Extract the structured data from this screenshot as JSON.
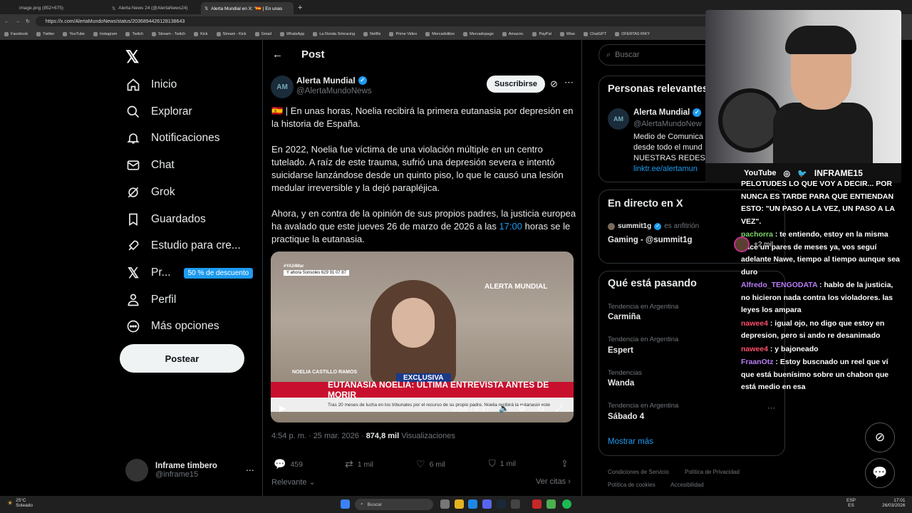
{
  "browser": {
    "tabs": [
      {
        "title": "image.png (852×675)"
      },
      {
        "title": "Alerta News 24 (@AlertaNews24)"
      },
      {
        "title": "Alerta Mundial en X: \"🇪🇸 | En unas"
      }
    ],
    "url": "https://x.com/AlertaMundoNews/status/2036894426128138643",
    "bookmarks": [
      "Facebook",
      "Twitter",
      "YouTube",
      "Instagram",
      "Twitch",
      "Stream - Twitch",
      "Kick",
      "Stream - Kick",
      "Gmail",
      "WhatsApp",
      "La Ronda Simracing",
      "Netflix",
      "Prime Video",
      "Mercadolibre",
      "Mercadopago",
      "Amazon.",
      "PayPal",
      "Wise",
      "ChatGPT",
      "OFERTAS RIKY"
    ]
  },
  "nav": {
    "items": [
      {
        "label": "Inicio",
        "icon": "home-icon"
      },
      {
        "label": "Explorar",
        "icon": "search-icon"
      },
      {
        "label": "Notificaciones",
        "icon": "bell-icon"
      },
      {
        "label": "Chat",
        "icon": "mail-icon"
      },
      {
        "label": "Grok",
        "icon": "grok-icon"
      },
      {
        "label": "Guardados",
        "icon": "bookmark-icon"
      },
      {
        "label": "Estudio para cre...",
        "icon": "rocket-icon"
      },
      {
        "label": "Pr...",
        "icon": "x-logo-icon"
      },
      {
        "label": "Perfil",
        "icon": "person-icon"
      },
      {
        "label": "Más opciones",
        "icon": "more-circle-icon"
      }
    ],
    "promo_badge": "50 % de descuento",
    "post_button": "Postear",
    "account": {
      "name": "Inframe timbero",
      "handle": "@inframe15"
    }
  },
  "post": {
    "header": "Post",
    "author": {
      "name": "Alerta Mundial",
      "handle": "@AlertaMundoNews"
    },
    "subscribe": "Suscribirse",
    "text_p1": "🇪🇸 | En unas horas, Noelia recibirá la primera eutanasia por depresión en la historia de España.",
    "text_p2": "En 2022, Noelia fue víctima de una violación múltiple en un centro tutelado. A raíz de este trauma, sufrió una depresión severa e intentó suicidarse lanzándose desde un quinto piso, lo que le causó una lesión medular irreversible y la dejó parapléjica.",
    "text_p3_a": "Ahora, y en contra de la opinión de sus propios padres, la justicia europea ha avalado que este jueves 26 de marzo de 2026 a las ",
    "text_p3_link": "17:00",
    "text_p3_b": " horas se le practique la eutanasia.",
    "media": {
      "tag": "#YA24Mar",
      "phone": "Y ahora Sonsoles  629 91 07 87",
      "brand": "ALERTA MUNDIAL",
      "name": "NOELIA CASTILLO RAMOS",
      "exclusive": "EXCLUSIVA",
      "headline": "EUTANASIA NOELIA: ÚLTIMA ENTREVISTA ANTES DE MORIR",
      "subline": "Tras 20 meses de lucha en los tribunales por el recurso de su propio padre, Noelia recibirá la eutanasia este",
      "time": "0:05 / 4:37"
    },
    "timestamp": "4:54 p. m. · 25 mar. 2026 · ",
    "views_count": "874,8 mil",
    "views_label": " Visualizaciones",
    "replies": "459",
    "reposts": "1 mil",
    "likes": "6 mil",
    "bookmarks": "1 mil",
    "relevant": "Relevante",
    "quotes": "Ver citas"
  },
  "right": {
    "search_placeholder": "Buscar",
    "relevant_title": "Personas relevantes",
    "rel_name": "Alerta Mundial",
    "rel_handle": "@AlertaMundoNew",
    "rel_bio_1": "Medio de Comunica",
    "rel_bio_2": "desde todo el mund",
    "rel_bio_3": "NUESTRAS REDES:",
    "rel_link": "linktr.ee/alertamun",
    "live_title": "En directo en X",
    "live_host": "summit1g",
    "live_host_tag": "es anfitrión",
    "live_count": "+2 mil",
    "live_stream": "Gaming - @summit1g",
    "trends_title": "Qué está pasando",
    "trends": [
      {
        "category": "Tendencia en Argentina",
        "name": "Carmiña"
      },
      {
        "category": "Tendencia en Argentina",
        "name": "Espert"
      },
      {
        "category": "Tendencias",
        "name": "Wanda"
      },
      {
        "category": "Tendencia en Argentina",
        "name": "Sábado 4"
      }
    ],
    "show_more": "Mostrar más",
    "footer": [
      "Condiciones de Servicio",
      "Política de Privacidad",
      "Política de cookies",
      "Accesibilidad"
    ]
  },
  "stream": {
    "cam_bar": [
      "YouTube",
      "INFRAME15"
    ],
    "chat": [
      {
        "user": "",
        "text": "PELOTUDES LO QUE VOY A DECIR... POR NUNCA ES TARDE PARA QUE ENTIENDAN ESTO: \"UN PASO A LA VEZ, UN PASO A LA VEZ\".",
        "color": "#ffffff"
      },
      {
        "user": "pachorra",
        "text": " : te entiendo, estoy en la misma hace un pares de meses ya, vos seguí adelante Nawe, tiempo al tiempo aunque sea duro",
        "color": "#7fd36b"
      },
      {
        "user": "Alfredo_TENGODATA",
        "text": " : hablo de la justicia, no hicieron nada contra los violadores. las leyes los ampara",
        "color": "#b97cf7"
      },
      {
        "user": "nawee4",
        "text": " : igual ojo, no digo que estoy en depresion, pero si ando re desanimado",
        "color": "#ff4f6d"
      },
      {
        "user": "nawee4",
        "text": " : y bajoneado",
        "color": "#ff4f6d"
      },
      {
        "user": "FraanOtz",
        "text": " : Estoy buscnado un reel que ví que está buenísimo sobre un chabon que está medio en esa",
        "color": "#b97cf7"
      }
    ]
  },
  "taskbar": {
    "weather_temp": "25°C",
    "weather_desc": "Soleado",
    "search": "Buscar",
    "lang1": "ESP",
    "lang2": "ES",
    "time": "17:01",
    "date": "26/03/2026"
  }
}
